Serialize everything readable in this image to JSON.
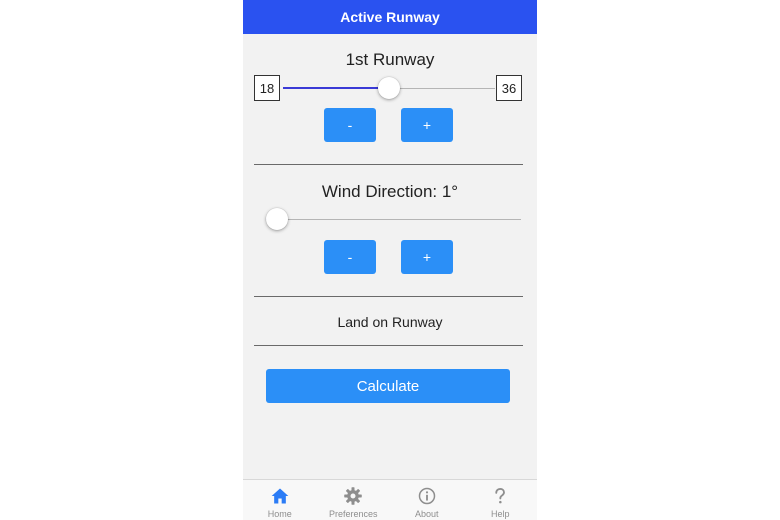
{
  "header": {
    "title": "Active Runway"
  },
  "runway": {
    "title": "1st Runway",
    "min_label": "18",
    "max_label": "36",
    "slider_value_fraction": 0.5,
    "minus_label": "-",
    "plus_label": "+"
  },
  "wind": {
    "title": "Wind Direction: 1°",
    "slider_value_fraction": 0.0,
    "minus_label": "-",
    "plus_label": "+"
  },
  "result": {
    "text": "Land on Runway"
  },
  "calculate": {
    "label": "Calculate"
  },
  "tabs": [
    {
      "label": "Home",
      "icon": "home-icon",
      "active": true
    },
    {
      "label": "Preferences",
      "icon": "gear-icon",
      "active": false
    },
    {
      "label": "About",
      "icon": "info-icon",
      "active": false
    },
    {
      "label": "Help",
      "icon": "question-mark-icon",
      "active": false
    }
  ],
  "colors": {
    "header_bg": "#2a52f0",
    "button_bg": "#2b8ff7",
    "active_tab": "#2b7cf6",
    "inactive_tab": "#8e8e8e",
    "slider_fill": "#3a3ad6"
  }
}
